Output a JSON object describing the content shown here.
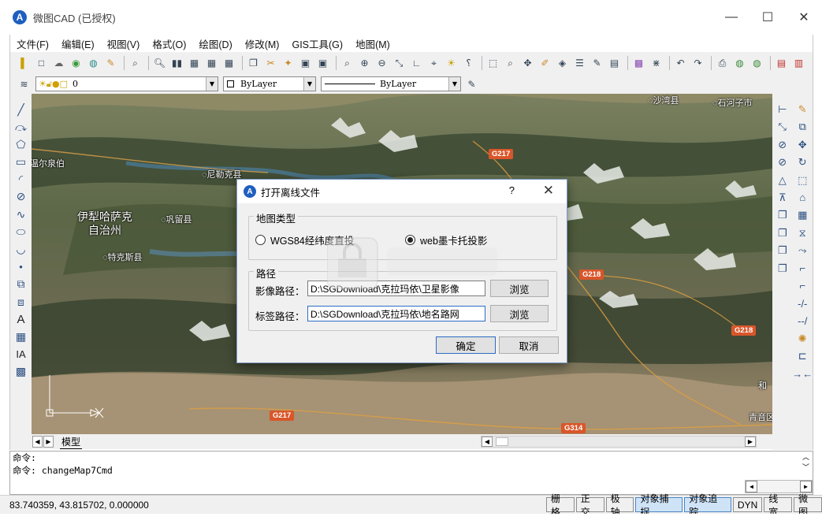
{
  "window": {
    "title": "微图CAD (已授权)",
    "logo_letter": "A",
    "minimize": "—",
    "maximize": "☐",
    "close": "✕"
  },
  "menu": [
    "文件(F)",
    "编辑(E)",
    "视图(V)",
    "格式(O)",
    "绘图(D)",
    "修改(M)",
    "GIS工具(G)",
    "地图(M)"
  ],
  "layer_toolbar": {
    "layer_name": "0",
    "color": "ByLayer",
    "linetype": "ByLayer"
  },
  "map": {
    "labels": [
      "沙湾县",
      "石河子市",
      "温尔泉伯",
      "尼勒克县",
      "巩留县",
      "特克斯县",
      "和",
      "青音区"
    ],
    "prefecture_label_line1": "伊犁哈萨克",
    "prefecture_label_line2": "自治州",
    "roads": [
      "G217",
      "G218",
      "G218",
      "G217",
      "G314"
    ]
  },
  "tabs": {
    "model_label": "模型"
  },
  "command": {
    "line1": "命令:",
    "line2": "命令: changeMap7Cmd"
  },
  "status": {
    "coords": "83.740359,  43.815702,  0.000000",
    "buttons": [
      {
        "label": "栅格",
        "on": false
      },
      {
        "label": "正交",
        "on": false
      },
      {
        "label": "极轴",
        "on": false
      },
      {
        "label": "对象捕捉",
        "on": true
      },
      {
        "label": "对象追踪",
        "on": true
      },
      {
        "label": "DYN",
        "on": false
      },
      {
        "label": "线宽",
        "on": false
      },
      {
        "label": "微图",
        "on": false
      }
    ]
  },
  "dialog": {
    "title": "打开离线文件",
    "help": "?",
    "close": "✕",
    "map_type_group": "地图类型",
    "option_wgs84": "WGS84经纬度直投",
    "option_web": "web墨卡托投影",
    "selected_option": "web",
    "path_group": "路径",
    "image_path_label": "影像路径：",
    "image_path_value": "D:\\SGDownload\\克拉玛依\\卫星影像",
    "label_path_label": "标签路径：",
    "label_path_value": "D:\\SGDownload\\克拉玛依\\地名路网",
    "browse": "浏览",
    "ok": "确定",
    "cancel": "取消"
  },
  "colors": {
    "accent": "#2b6cc4",
    "road_badge": "#d9562a"
  }
}
